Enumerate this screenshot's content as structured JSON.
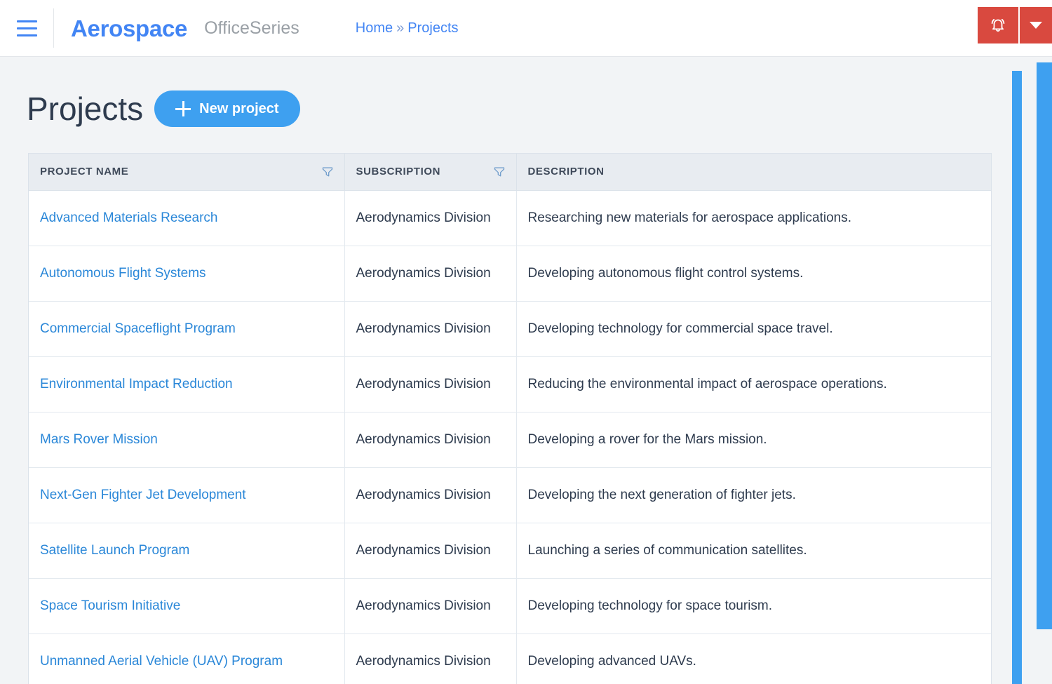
{
  "topbar": {
    "menu_icon": "hamburger-icon",
    "brand": "Aerospace",
    "brand_suffix": "OfficeSeries",
    "breadcrumb": {
      "home": "Home",
      "separator": "»",
      "current": "Projects"
    },
    "alert_icon": "bell-icon",
    "alert_caret_icon": "chevron-down-icon",
    "alert_color": "#d9493f"
  },
  "page": {
    "title": "Projects",
    "new_project_label": "New project",
    "new_project_icon": "plus-icon",
    "accent_color": "#3ea0f0",
    "link_color": "#2a87d8",
    "background": "#f2f4f6"
  },
  "table": {
    "columns": [
      {
        "label": "PROJECT NAME",
        "filterable": true,
        "filter_icon": "filter-icon"
      },
      {
        "label": "SUBSCRIPTION",
        "filterable": true,
        "filter_icon": "filter-icon"
      },
      {
        "label": "DESCRIPTION",
        "filterable": false
      }
    ],
    "rows": [
      {
        "name": "Advanced Materials Research",
        "subscription": "Aerodynamics Division",
        "description": "Researching new materials for aerospace applications."
      },
      {
        "name": "Autonomous Flight Systems",
        "subscription": "Aerodynamics Division",
        "description": "Developing autonomous flight control systems."
      },
      {
        "name": "Commercial Spaceflight Program",
        "subscription": "Aerodynamics Division",
        "description": "Developing technology for commercial space travel."
      },
      {
        "name": "Environmental Impact Reduction",
        "subscription": "Aerodynamics Division",
        "description": "Reducing the environmental impact of aerospace operations."
      },
      {
        "name": "Mars Rover Mission",
        "subscription": "Aerodynamics Division",
        "description": "Developing a rover for the Mars mission."
      },
      {
        "name": "Next-Gen Fighter Jet Development",
        "subscription": "Aerodynamics Division",
        "description": "Developing the next generation of fighter jets."
      },
      {
        "name": "Satellite Launch Program",
        "subscription": "Aerodynamics Division",
        "description": "Launching a series of communication satellites."
      },
      {
        "name": "Space Tourism Initiative",
        "subscription": "Aerodynamics Division",
        "description": "Developing technology for space tourism."
      },
      {
        "name": "Unmanned Aerial Vehicle (UAV) Program",
        "subscription": "Aerodynamics Division",
        "description": "Developing advanced UAVs."
      }
    ]
  },
  "scrollbars": {
    "inner_thumb_color": "#3ea0f0",
    "outer_thumb_color": "#3ea0f0"
  }
}
